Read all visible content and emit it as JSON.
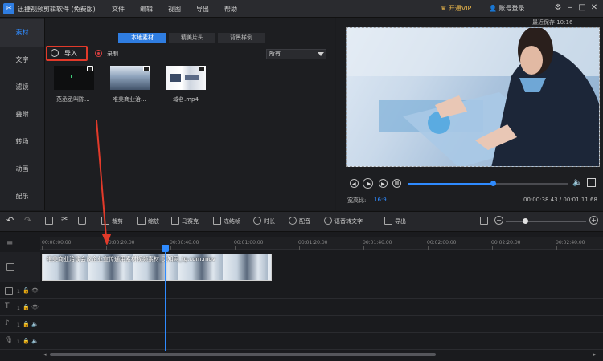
{
  "titlebar": {
    "app_title": "迅捷视频剪辑软件 (免费版)",
    "menu": [
      "文件",
      "编辑",
      "视图",
      "导出",
      "帮助"
    ],
    "vip_label": "开通VIP",
    "login_label": "账号登录",
    "last_save": "最近保存 10:16"
  },
  "sidebar": {
    "items": [
      {
        "label": "素材",
        "active": true
      },
      {
        "label": "文字",
        "active": false
      },
      {
        "label": "滤镜",
        "active": false
      },
      {
        "label": "叠附",
        "active": false
      },
      {
        "label": "转场",
        "active": false
      },
      {
        "label": "动画",
        "active": false
      },
      {
        "label": "配乐",
        "active": false
      }
    ]
  },
  "library": {
    "tabs": [
      "本地素材",
      "精美片头",
      "背景样例"
    ],
    "import_label": "导入",
    "record_label": "录制",
    "filter_value": "所有",
    "items": [
      {
        "label": "范丞丞叫陈..."
      },
      {
        "label": "唯美商业洽..."
      },
      {
        "label": "域名.mp4"
      }
    ]
  },
  "preview": {
    "aspect_label": "宽高比:",
    "aspect_value": "16:9",
    "time_display": "00:00:38.43 / 00:01:11.68",
    "progress": 0.53
  },
  "toolbar": {
    "tools": [
      "裁剪",
      "缩放",
      "马赛克",
      "冻结帧",
      "时长",
      "配音",
      "语音转文字",
      "导出"
    ],
    "zoom": 0.24
  },
  "timeline": {
    "ruler": [
      "00:00:00.00",
      "00:00:20.00",
      "00:00:40.00",
      "00:01:00.00",
      "00:01:20.00",
      "00:01:40.00",
      "00:02:00.00",
      "00:02:20.00",
      "00:02:40.00"
    ],
    "clip_name": "唯美商业洽谈会议企业宣传通用素材视频素材_觅知网_tg.com.mov",
    "track_numbers": [
      "1",
      "1",
      "1",
      "1"
    ]
  },
  "colors": {
    "accent": "#2f8bff",
    "highlight": "#e23a2a",
    "vip": "#e8b54b"
  }
}
